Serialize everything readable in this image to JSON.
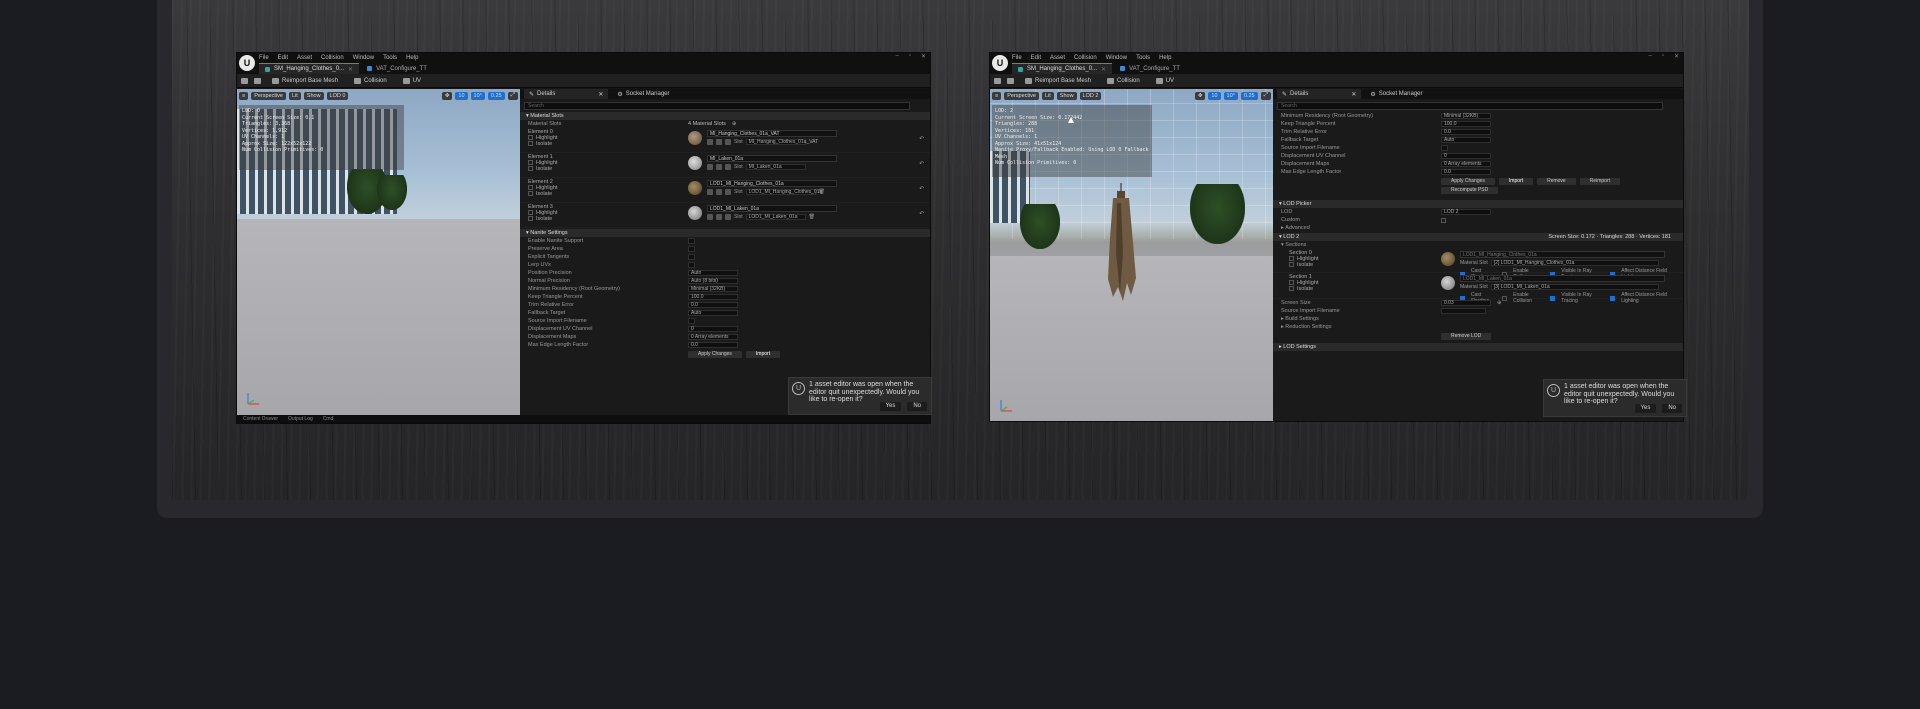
{
  "window1": {
    "menu": [
      "File",
      "Edit",
      "Asset",
      "Collision",
      "Window",
      "Tools",
      "Help"
    ],
    "tabs": [
      "SM_Hanging_Clothes_0...",
      "VAT_Configure_TT"
    ],
    "toolbar": [
      "Reimport Base Mesh",
      "Collision",
      "UV"
    ],
    "viewport_chips": [
      "Perspective",
      "Lit",
      "Show",
      "LOD 0",
      "10",
      "10°",
      "0.25"
    ],
    "stats": [
      "LOD: 0",
      "Current Screen Size: 0.1",
      "Triangles: 3,368",
      "Vertices: 1,912",
      "UV Channels: 1",
      "Approx Size: 122x52x122",
      "Num Collision Primitives: 0"
    ],
    "details_tabs": [
      "Details",
      "Socket Manager"
    ],
    "search_placeholder": "Search",
    "sections": {
      "material_slots": "Material Slots",
      "nanite": "Nanite Settings"
    },
    "material_slots_label": "Material Slots",
    "material_slots_count": "4 Material Slots",
    "slots": [
      {
        "element": "Element 0",
        "material": "MI_Hanging_Clothes_01a_VAT",
        "slot": "MI_Hanging_Clothes_01a_VAT"
      },
      {
        "element": "Element 1",
        "material": "MI_Laken_01a",
        "slot": "MI_Laken_01a"
      },
      {
        "element": "Element 2",
        "material": "LOD1_MI_Hanging_Clothes_01a",
        "slot": "LOD1_MI_Hanging_Clothes_01a"
      },
      {
        "element": "Element 3",
        "material": "LOD1_MI_Laken_01a",
        "slot": "LOD1_MI_Laken_01a"
      }
    ],
    "slot_sub": [
      "Highlight",
      "Isolate"
    ],
    "slot_label": "Slot",
    "nanite_rows": [
      {
        "label": "Enable Nanite Support",
        "value": ""
      },
      {
        "label": "Preserve Area",
        "value": ""
      },
      {
        "label": "Explicit Tangents",
        "value": ""
      },
      {
        "label": "Lerp UVs",
        "value": ""
      },
      {
        "label": "Position Precision",
        "value": "Auto"
      },
      {
        "label": "Normal Precision",
        "value": "Auto (8 bits)"
      },
      {
        "label": "Minimum Residency (Root Geometry)",
        "value": "Minimal (32KB)"
      },
      {
        "label": "Keep Triangle Percent",
        "value": "100.0"
      },
      {
        "label": "Trim Relative Error",
        "value": "0.0"
      },
      {
        "label": "Fallback Target",
        "value": "Auto"
      },
      {
        "label": "Source Import Filename",
        "value": ""
      },
      {
        "label": "Displacement UV Channel",
        "value": "0"
      },
      {
        "label": "Displacement Maps",
        "value": "0 Array elements"
      },
      {
        "label": "Max Edge Length Factor",
        "value": "0.0"
      }
    ],
    "nanite_buttons": [
      "Apply Changes",
      "Import"
    ],
    "bottom_tabs": [
      "Content Drawer",
      "Output Log",
      "Cmd"
    ]
  },
  "window2": {
    "menu": [
      "File",
      "Edit",
      "Asset",
      "Collision",
      "Window",
      "Tools",
      "Help"
    ],
    "tabs": [
      "SM_Hanging_Clothes_0...",
      "VAT_Configure_TT"
    ],
    "toolbar": [
      "Reimport Base Mesh",
      "Collision",
      "UV"
    ],
    "viewport_chips": [
      "Perspective",
      "Lit",
      "Show",
      "LOD 2",
      "10",
      "10°",
      "0.25"
    ],
    "stats": [
      "LOD: 2",
      "Current Screen Size: 0.172442",
      "Triangles: 288",
      "Vertices: 181",
      "UV Channels: 1",
      "Approx Size: 41x51x124",
      "Nanite Proxy/Fallback Enabled: Using LOD 0 Fallback Mesh",
      "Num Collision Primitives: 0"
    ],
    "details_tabs": [
      "Details",
      "Socket Manager"
    ],
    "search_placeholder": "Search",
    "top_rows": [
      {
        "label": "Minimum Residency (Root Geometry)",
        "value": "Minimal (32KB)"
      },
      {
        "label": "Keep Triangle Percent",
        "value": "100.0"
      },
      {
        "label": "Trim Relative Error",
        "value": "0.0"
      },
      {
        "label": "Fallback Target",
        "value": "Auto"
      },
      {
        "label": "Source Import Filename",
        "value": ""
      },
      {
        "label": "Displacement UV Channel",
        "value": "0"
      },
      {
        "label": "Displacement Maps",
        "value": "0 Array elements"
      },
      {
        "label": "Max Edge Length Factor",
        "value": "0.0"
      }
    ],
    "top_buttons": [
      "Apply Changes",
      "Import",
      "Remove",
      "Reimport"
    ],
    "recompute_btn": "Recompute PSD",
    "lod_picker": {
      "title": "LOD Picker",
      "lod_label": "LOD",
      "lod_value": "LOD 2",
      "custom": "Custom",
      "advanced": "Advanced"
    },
    "lod2": {
      "title": "LOD 2",
      "info": "Screen Size: 0.172 · Triangles: 288 · Vertices: 181",
      "sections_label": "Sections"
    },
    "sections": [
      {
        "name": "Section 0",
        "material": "LOD1_MI_Hanging_Clothes_01a",
        "slot": "[2] LOD1_MI_Hanging_Clothes_01a"
      },
      {
        "name": "Section 1",
        "material": "LOD1_MI_Laken_01a",
        "slot": "[3] LOD1_MI_Laken_01a"
      }
    ],
    "section_flags": [
      "Cast Shadow",
      "Enable Collision",
      "Visible In Ray Tracing",
      "Affect Distance Field Lighting"
    ],
    "material_slot_label": "Material Slot",
    "screen_size_label": "Screen Size",
    "screen_size_value": "0.03",
    "source_import": "Source Import Filename",
    "build_settings": "Build Settings",
    "reduction_settings": "Reduction Settings",
    "remove_lod": "Remove LOD",
    "lod_settings": "LOD Settings"
  },
  "notification": {
    "text": "1 asset editor was open when the editor quit unexpectedly. Would you like to re-open it?",
    "yes": "Yes",
    "no": "No"
  },
  "colors": {
    "accent": "#1e6fd0",
    "teal": "#27a7a7"
  }
}
